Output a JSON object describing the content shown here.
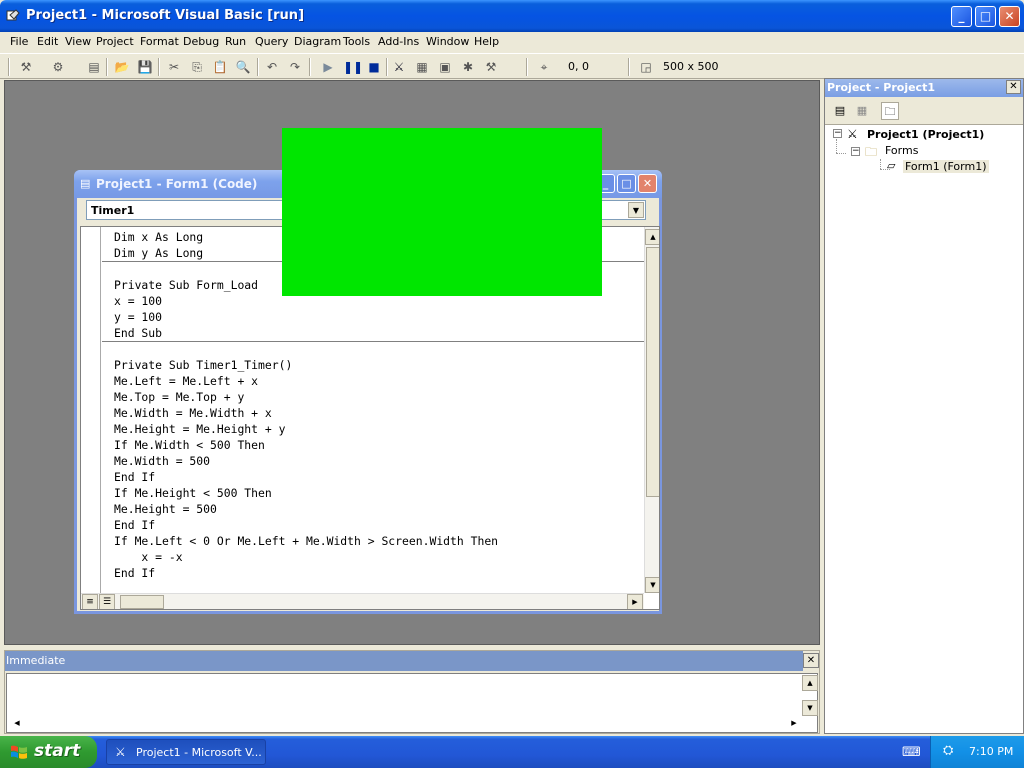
{
  "window": {
    "title": "Project1 - Microsoft Visual Basic [run]"
  },
  "menu": [
    "File",
    "Edit",
    "View",
    "Project",
    "Format",
    "Debug",
    "Run",
    "Query",
    "Diagram",
    "Tools",
    "Add-Ins",
    "Window",
    "Help"
  ],
  "toolbar": {
    "position": "0, 0",
    "size": "500 x 500"
  },
  "code_window": {
    "title": "Project1 - Form1 (Code)",
    "object_combo": "Timer1",
    "lines": [
      "Dim x As Long",
      "Dim y As Long",
      "",
      "Private Sub Form_Load",
      "x = 100",
      "y = 100",
      "End Sub",
      "",
      "Private Sub Timer1_Timer()",
      "Me.Left = Me.Left + x",
      "Me.Top = Me.Top + y",
      "Me.Width = Me.Width + x",
      "Me.Height = Me.Height + y",
      "If Me.Width < 500 Then",
      "Me.Width = 500",
      "End If",
      "If Me.Height < 500 Then",
      "Me.Height = 500",
      "End If",
      "If Me.Left < 0 Or Me.Left + Me.Width > Screen.Width Then",
      "    x = -x",
      "End If"
    ]
  },
  "form_color": "#00e600",
  "project_panel": {
    "title": "Project - Project1",
    "tree": {
      "project": "Project1 (Project1)",
      "folder": "Forms",
      "form": "Form1 (Form1)"
    }
  },
  "immediate": {
    "title": "Immediate"
  },
  "taskbar": {
    "start": "start",
    "task": "Project1 - Microsoft V...",
    "clock": "7:10 PM"
  },
  "colors": {
    "titlebar": "#0554e3",
    "taskbar": "#245edb",
    "start": "#3c9c3c",
    "green_form": "#00e600"
  }
}
